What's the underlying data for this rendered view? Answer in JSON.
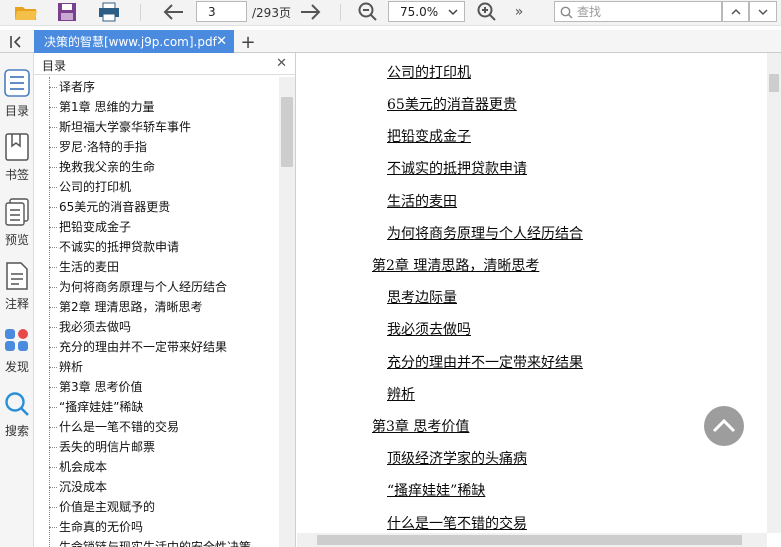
{
  "toolbar": {
    "page_current": "3",
    "page_total": "/293页",
    "zoom": "75.0%",
    "search_placeholder": "查找"
  },
  "tabs": [
    {
      "label": "决策的智慧[www.j9p.com].pdf"
    }
  ],
  "rail": {
    "toc": "目录",
    "bookmarks": "书签",
    "preview": "预览",
    "annotations": "注释",
    "discover": "发现",
    "search": "搜索"
  },
  "toc": {
    "title": "目录",
    "items": [
      "译者序",
      "第1章 思维的力量",
      "斯坦福大学豪华轿车事件",
      "罗尼·洛特的手指",
      "挽救我父亲的生命",
      "公司的打印机",
      "65美元的消音器更贵",
      "把铅变成金子",
      "不诚实的抵押贷款申请",
      "生活的麦田",
      "为何将商务原理与个人经历结合",
      "第2章 理清思路，清晰思考",
      "我必须去做吗",
      "充分的理由并不一定带来好结果",
      "辨析",
      "第3章 思考价值",
      "“搔痒娃娃”稀缺",
      "什么是一笔不错的交易",
      "丢失的明信片邮票",
      "机会成本",
      "沉没成本",
      "价值是主观赋予的",
      "生命真的无价吗",
      "生命锁链与现实生活中的安全性决策"
    ]
  },
  "document": {
    "lines": [
      "公司的打印机",
      "65美元的消音器更贵",
      "把铅变成金子",
      "不诚实的抵押贷款申请",
      "生活的麦田",
      "为何将商务原理与个人经历结合",
      "第2章 理清思路，清晰思考",
      "思考边际量",
      "我必须去做吗",
      "充分的理由并不一定带来好结果",
      "辨析",
      "第3章 思考价值",
      "顶级经济学家的头痛病",
      "“搔痒娃娃”稀缺",
      "什么是一笔不错的交易"
    ]
  }
}
